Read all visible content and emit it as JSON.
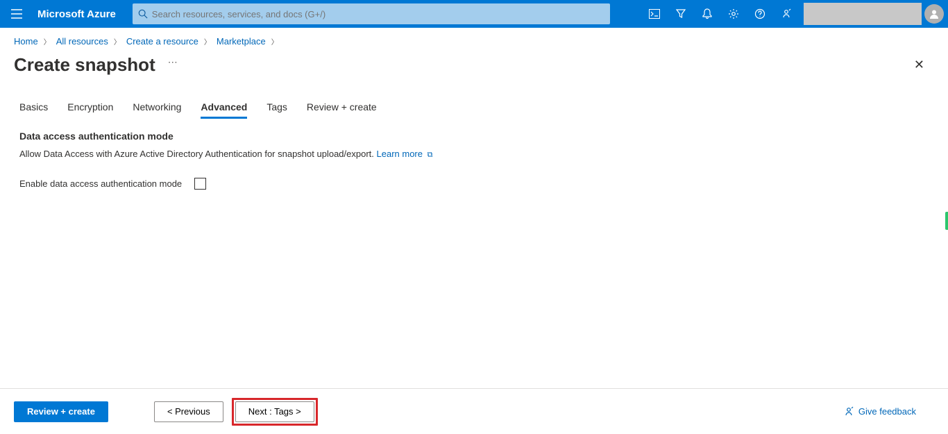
{
  "brand": "Microsoft Azure",
  "search": {
    "placeholder": "Search resources, services, and docs (G+/)"
  },
  "breadcrumb": [
    "Home",
    "All resources",
    "Create a resource",
    "Marketplace"
  ],
  "page": {
    "title": "Create snapshot"
  },
  "tabs": [
    "Basics",
    "Encryption",
    "Networking",
    "Advanced",
    "Tags",
    "Review + create"
  ],
  "active_tab": "Advanced",
  "section": {
    "heading": "Data access authentication mode",
    "description": "Allow Data Access with Azure Active Directory Authentication for snapshot upload/export.",
    "learn_more": "Learn more",
    "checkbox_label": "Enable data access authentication mode"
  },
  "footer": {
    "review": "Review + create",
    "prev": "< Previous",
    "next": "Next : Tags >",
    "feedback": "Give feedback"
  }
}
